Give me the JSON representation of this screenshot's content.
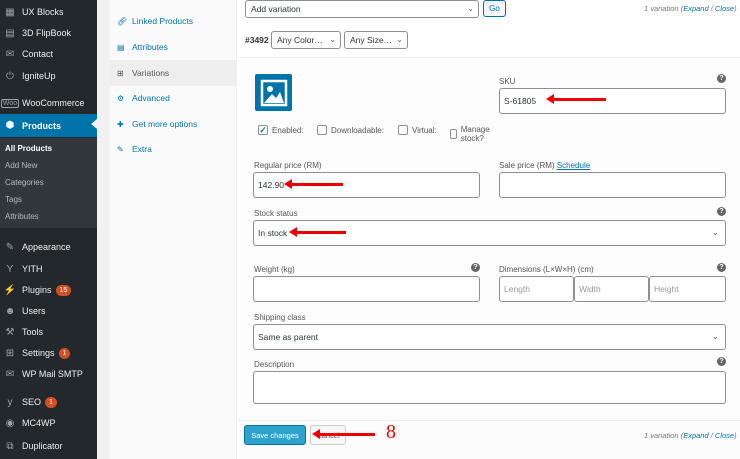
{
  "sidebar": {
    "items": [
      {
        "label": "UX Blocks",
        "icon": "blocks-icon"
      },
      {
        "label": "3D FlipBook",
        "icon": "book-icon"
      },
      {
        "label": "Contact",
        "icon": "mail-icon"
      },
      {
        "label": "IgniteUp",
        "icon": "power-icon"
      },
      {
        "label": "WooCommerce",
        "icon": "woocommerce-icon"
      },
      {
        "label": "Products",
        "icon": "box-icon"
      },
      {
        "label": "Appearance",
        "icon": "paintbrush-icon"
      },
      {
        "label": "YITH",
        "icon": "yith-icon"
      },
      {
        "label": "Plugins",
        "icon": "plugin-icon",
        "badge": "15"
      },
      {
        "label": "Users",
        "icon": "users-icon"
      },
      {
        "label": "Tools",
        "icon": "wrench-icon"
      },
      {
        "label": "Settings",
        "icon": "settings-icon",
        "badge": "1"
      },
      {
        "label": "WP Mail SMTP",
        "icon": "mail-smtp-icon"
      },
      {
        "label": "SEO",
        "icon": "yoast-icon",
        "badge": "1"
      },
      {
        "label": "MC4WP",
        "icon": "mc4wp-icon"
      },
      {
        "label": "Duplicator",
        "icon": "duplicator-icon"
      }
    ],
    "submenu": [
      "All Products",
      "Add New",
      "Categories",
      "Tags",
      "Attributes"
    ],
    "woo_badge": "Woo"
  },
  "tabs": [
    {
      "label": "Linked Products",
      "icon": "link-icon"
    },
    {
      "label": "Attributes",
      "icon": "list-icon"
    },
    {
      "label": "Variations",
      "icon": "grid-icon"
    },
    {
      "label": "Advanced",
      "icon": "gear-icon"
    },
    {
      "label": "Get more options",
      "icon": "plug-icon"
    },
    {
      "label": "Extra",
      "icon": "wrench-icon"
    }
  ],
  "toolbar": {
    "add_variation": "Add variation",
    "go": "Go",
    "count_text": "1 variation (",
    "expand": "Expand",
    "sep": " / ",
    "close": "Close",
    "count_end": ")"
  },
  "variation": {
    "id": "#3492",
    "color_select": "Any Color…",
    "size_select": "Any Size…",
    "sku_label": "SKU",
    "sku_value": "S-61805",
    "enabled_label": "Enabled:",
    "downloadable_label": "Downloadable:",
    "virtual_label": "Virtual:",
    "manage_stock_label": "Manage stock?",
    "enabled": true,
    "downloadable": false,
    "virtual": false,
    "manage_stock": false,
    "regular_price_label": "Regular price (RM)",
    "regular_price": "142.90",
    "sale_price_label": "Sale price (RM)",
    "schedule_link": "Schedule",
    "stock_status_label": "Stock status",
    "stock_status": "In stock",
    "weight_label": "Weight (kg)",
    "dimensions_label": "Dimensions (L×W×H) (cm)",
    "length_ph": "Length",
    "width_ph": "Width",
    "height_ph": "Height",
    "shipping_class_label": "Shipping class",
    "shipping_class": "Same as parent",
    "description_label": "Description",
    "help": "?"
  },
  "actions": {
    "save": "Save changes",
    "cancel": "Cancel"
  },
  "annotation": {
    "step": "8",
    "color": "#ee0000"
  }
}
